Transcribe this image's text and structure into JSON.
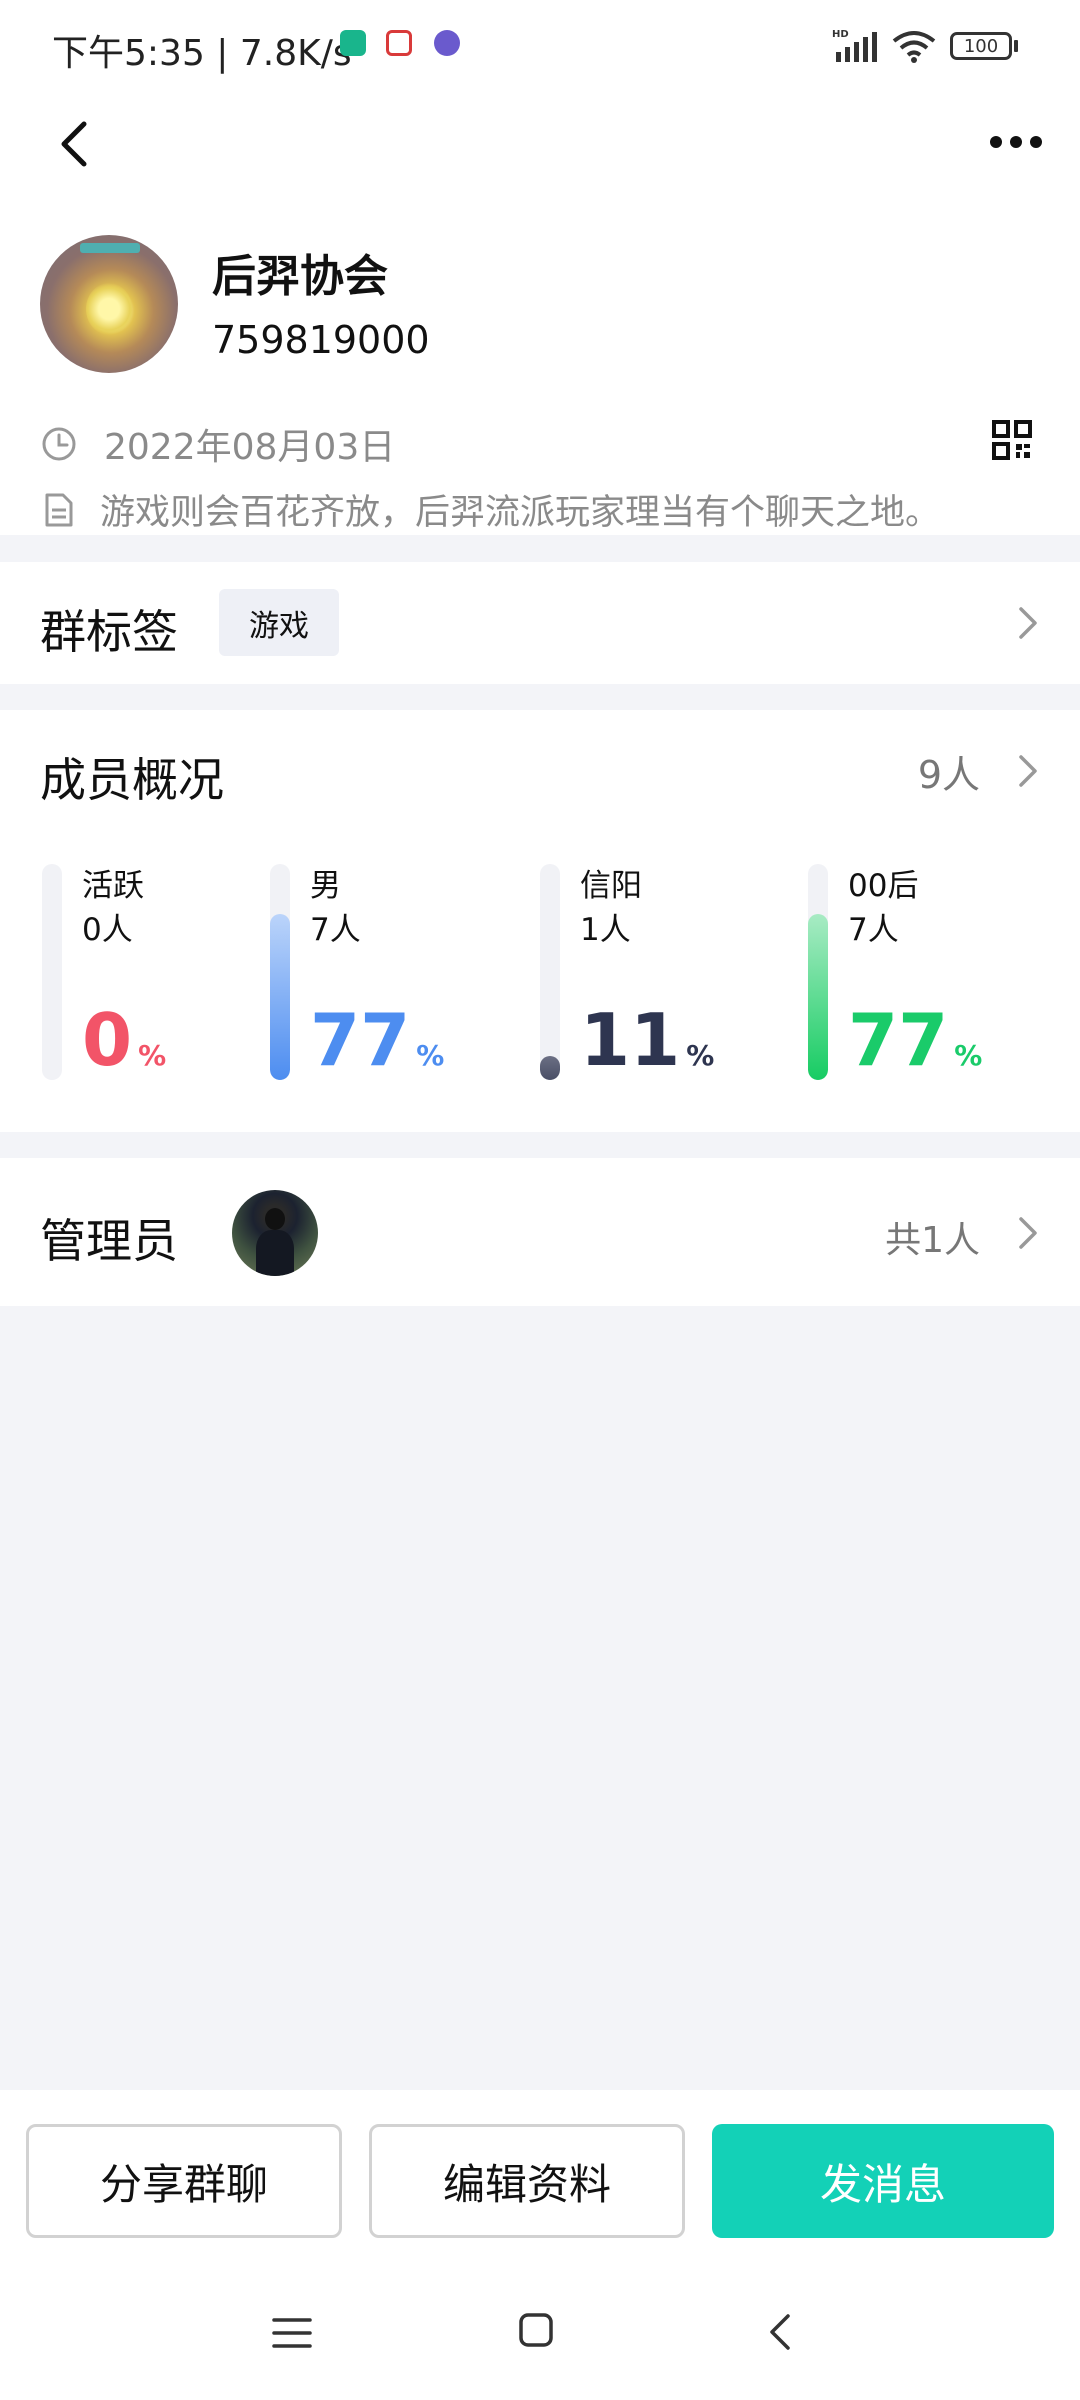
{
  "status_bar": {
    "time": "下午5:35 | 7.8K/s",
    "hd_label": "HD",
    "battery": "100",
    "mini_icons": [
      "app-icon",
      "app-icon",
      "app-icon"
    ]
  },
  "header": {
    "group_name": "后羿协会",
    "group_id": "759819000",
    "date": "2022年08月03日",
    "description": "游戏则会百花齐放，后羿流派玩家理当有个聊天之地。"
  },
  "tags": {
    "title": "群标签",
    "items": [
      "游戏"
    ]
  },
  "members": {
    "title": "成员概况",
    "count": "9人",
    "stats": [
      {
        "label": "活跃",
        "count": "0人",
        "percent": "0",
        "unit": "%",
        "fill": 0,
        "color": "#F25468",
        "fill_gradient": [
          "#F25468",
          "#F25468"
        ]
      },
      {
        "label": "男",
        "count": "7人",
        "percent": "77",
        "unit": "%",
        "fill": 0.77,
        "color": "#4D8DF0",
        "fill_gradient": [
          "#BBD4FA",
          "#4D8DF0"
        ]
      },
      {
        "label": "信阳",
        "count": "1人",
        "percent": "11",
        "unit": "%",
        "fill": 0.11,
        "color": "#2E3550",
        "fill_gradient": [
          "#6B6F84",
          "#4A4F66"
        ]
      },
      {
        "label": "00后",
        "count": "7人",
        "percent": "77",
        "unit": "%",
        "fill": 0.77,
        "color": "#1ACB6A",
        "fill_gradient": [
          "#A8EBC4",
          "#17CC63"
        ]
      }
    ]
  },
  "admins": {
    "title": "管理员",
    "count": "共1人"
  },
  "actions": {
    "share": "分享群聊",
    "edit": "编辑资料",
    "send": "发消息"
  },
  "colors": {
    "accent": "#13D1B7",
    "background": "#F3F4F8"
  }
}
